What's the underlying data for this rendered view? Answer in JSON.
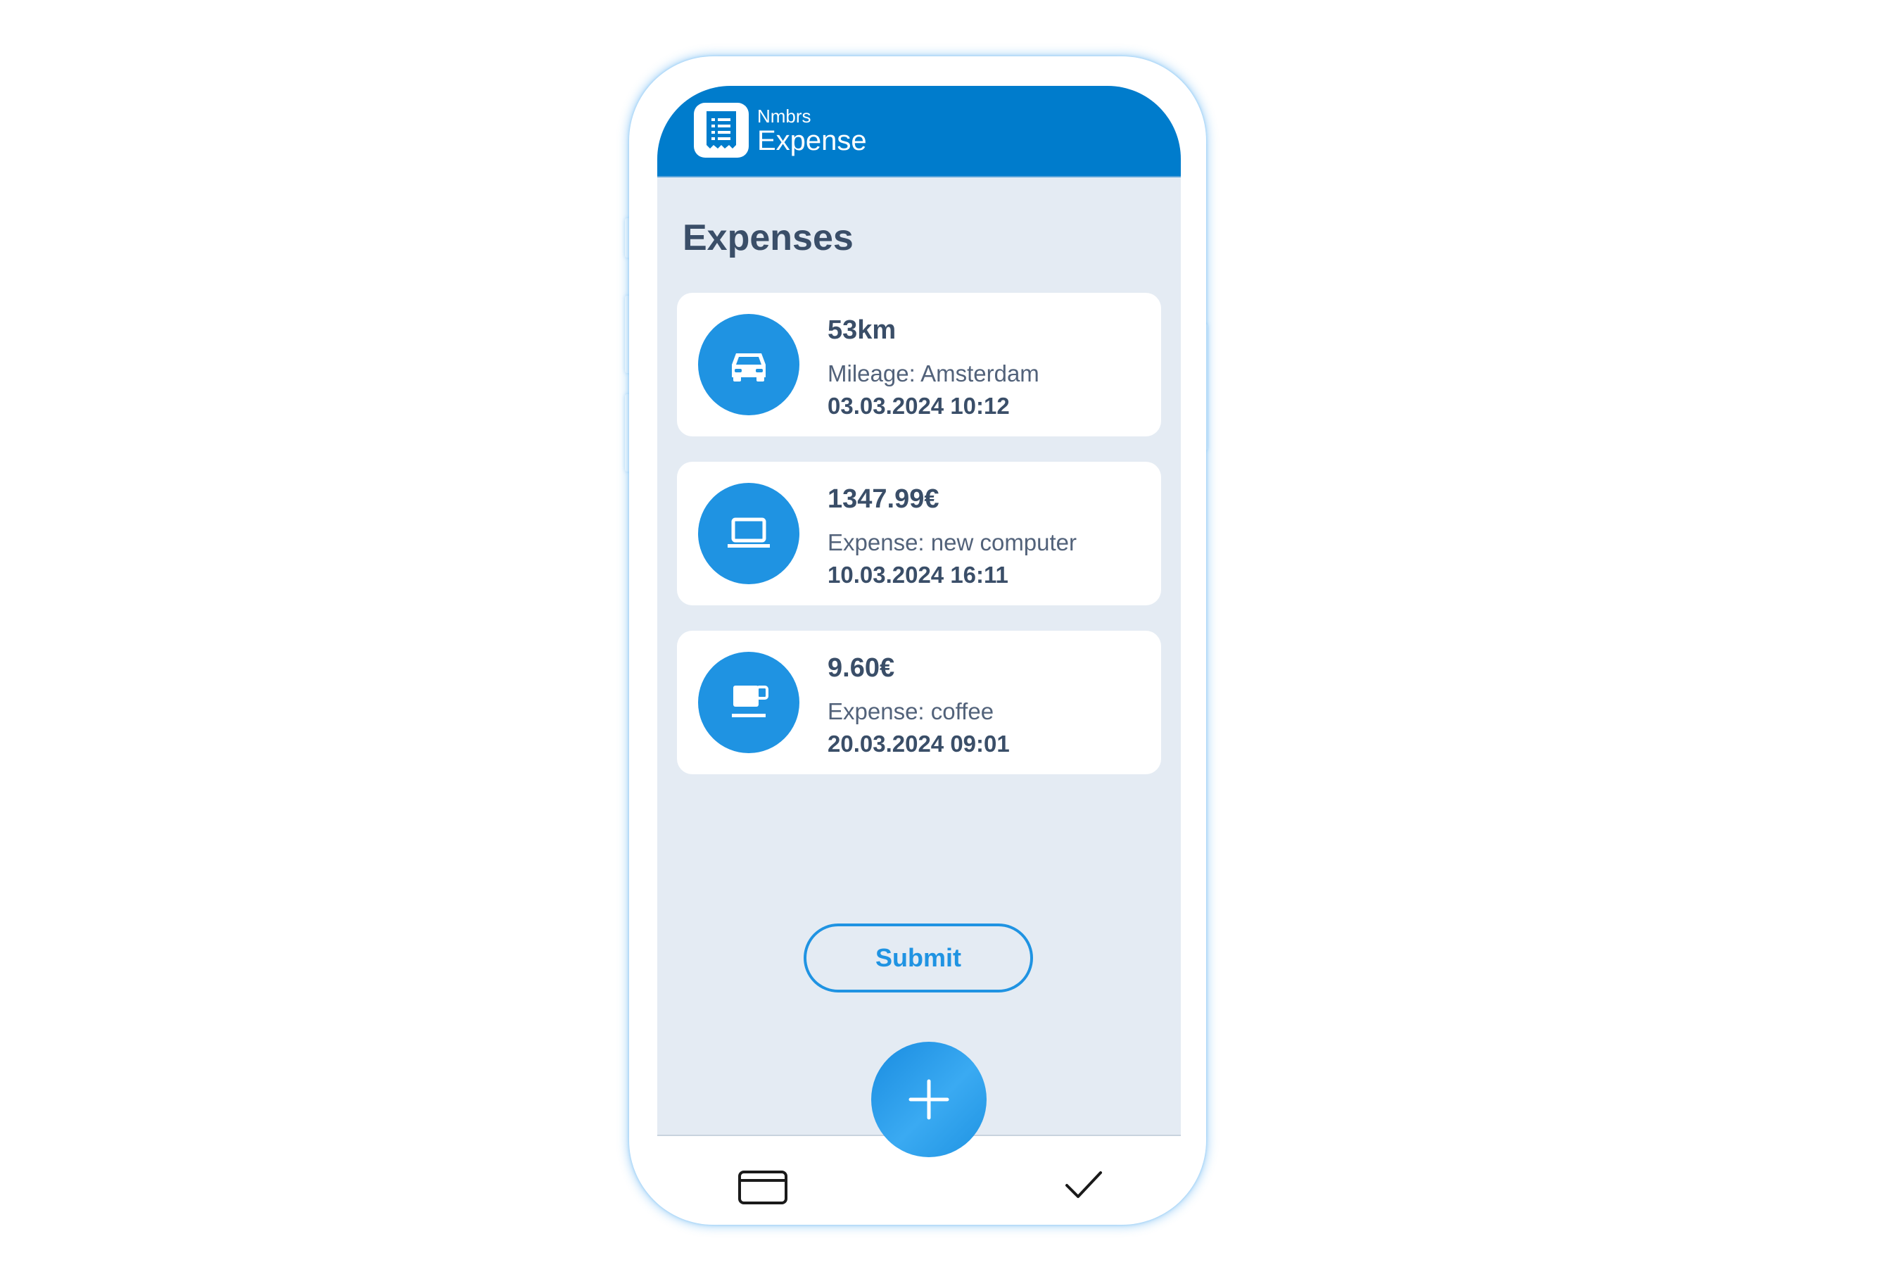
{
  "app": {
    "brand_small": "Nmbrs",
    "brand_big": "Expense",
    "logo_icon": "receipt-icon"
  },
  "page": {
    "title": "Expenses"
  },
  "expenses": [
    {
      "amount": "53km",
      "description": "Mileage: Amsterdam",
      "date": "03.03.2024 10:12",
      "icon": "car-icon"
    },
    {
      "amount": "1347.99€",
      "description": "Expense: new computer",
      "date": "10.03.2024 16:11",
      "icon": "laptop-icon"
    },
    {
      "amount": "9.60€",
      "description": "Expense: coffee",
      "date": "20.03.2024 09:01",
      "icon": "coffee-cup-icon"
    }
  ],
  "actions": {
    "submit_label": "Submit"
  },
  "bottom_nav": {
    "left_icon": "credit-card-icon",
    "center_icon": "plus-icon",
    "right_icon": "checkmark-icon"
  },
  "colors": {
    "header": "#007ccc",
    "accent": "#1f93e2",
    "background": "#e4ebf3",
    "text_dark": "#3a4e68"
  }
}
